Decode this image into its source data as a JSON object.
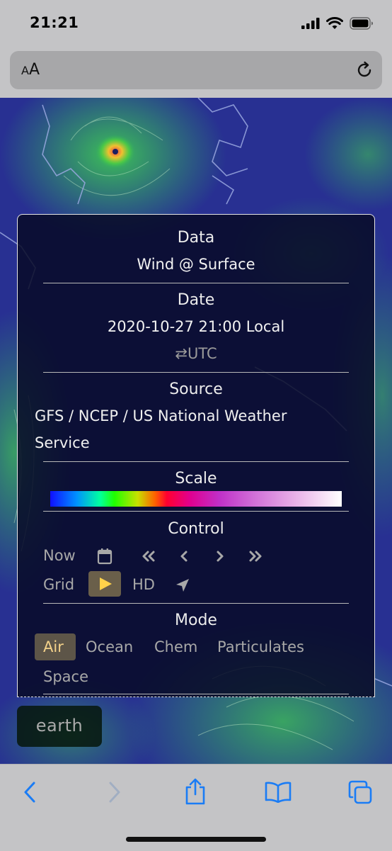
{
  "status_bar": {
    "time": "21:21",
    "icons": [
      "cellular-signal-icon",
      "wifi-icon",
      "battery-icon"
    ]
  },
  "url_bar": {
    "text_size_label_small": "A",
    "text_size_label_large": "A",
    "reload_icon": "reload-icon"
  },
  "menu": {
    "data": {
      "title": "Data",
      "value": "Wind @ Surface"
    },
    "date": {
      "title": "Date",
      "value": "2020-10-27 21:00 Local",
      "toggle": "⇄UTC"
    },
    "source": {
      "title": "Source",
      "value_line1": "GFS / NCEP / US National Weather",
      "value_line2": "Service"
    },
    "scale": {
      "title": "Scale"
    },
    "control": {
      "title": "Control",
      "now": "Now",
      "calendar_icon": "calendar-icon",
      "nav_icons": [
        "double-chevron-left-icon",
        "chevron-left-icon",
        "chevron-right-icon",
        "double-chevron-right-icon"
      ],
      "grid": "Grid",
      "play_icon": "play-icon",
      "hd": "HD",
      "locate_icon": "location-arrow-icon"
    },
    "mode": {
      "title": "Mode",
      "items": [
        "Air",
        "Ocean",
        "Chem",
        "Particulates",
        "Space"
      ],
      "selected": "Air"
    }
  },
  "earth_button": {
    "label": "earth"
  },
  "toolbar": {
    "icons": [
      "back-icon",
      "forward-icon",
      "share-icon",
      "bookmarks-icon",
      "tabs-icon"
    ]
  },
  "colors": {
    "accent_blue": "#1a7cf5",
    "selected_bg": "#5d5548",
    "play_icon": "#ffd24a"
  }
}
